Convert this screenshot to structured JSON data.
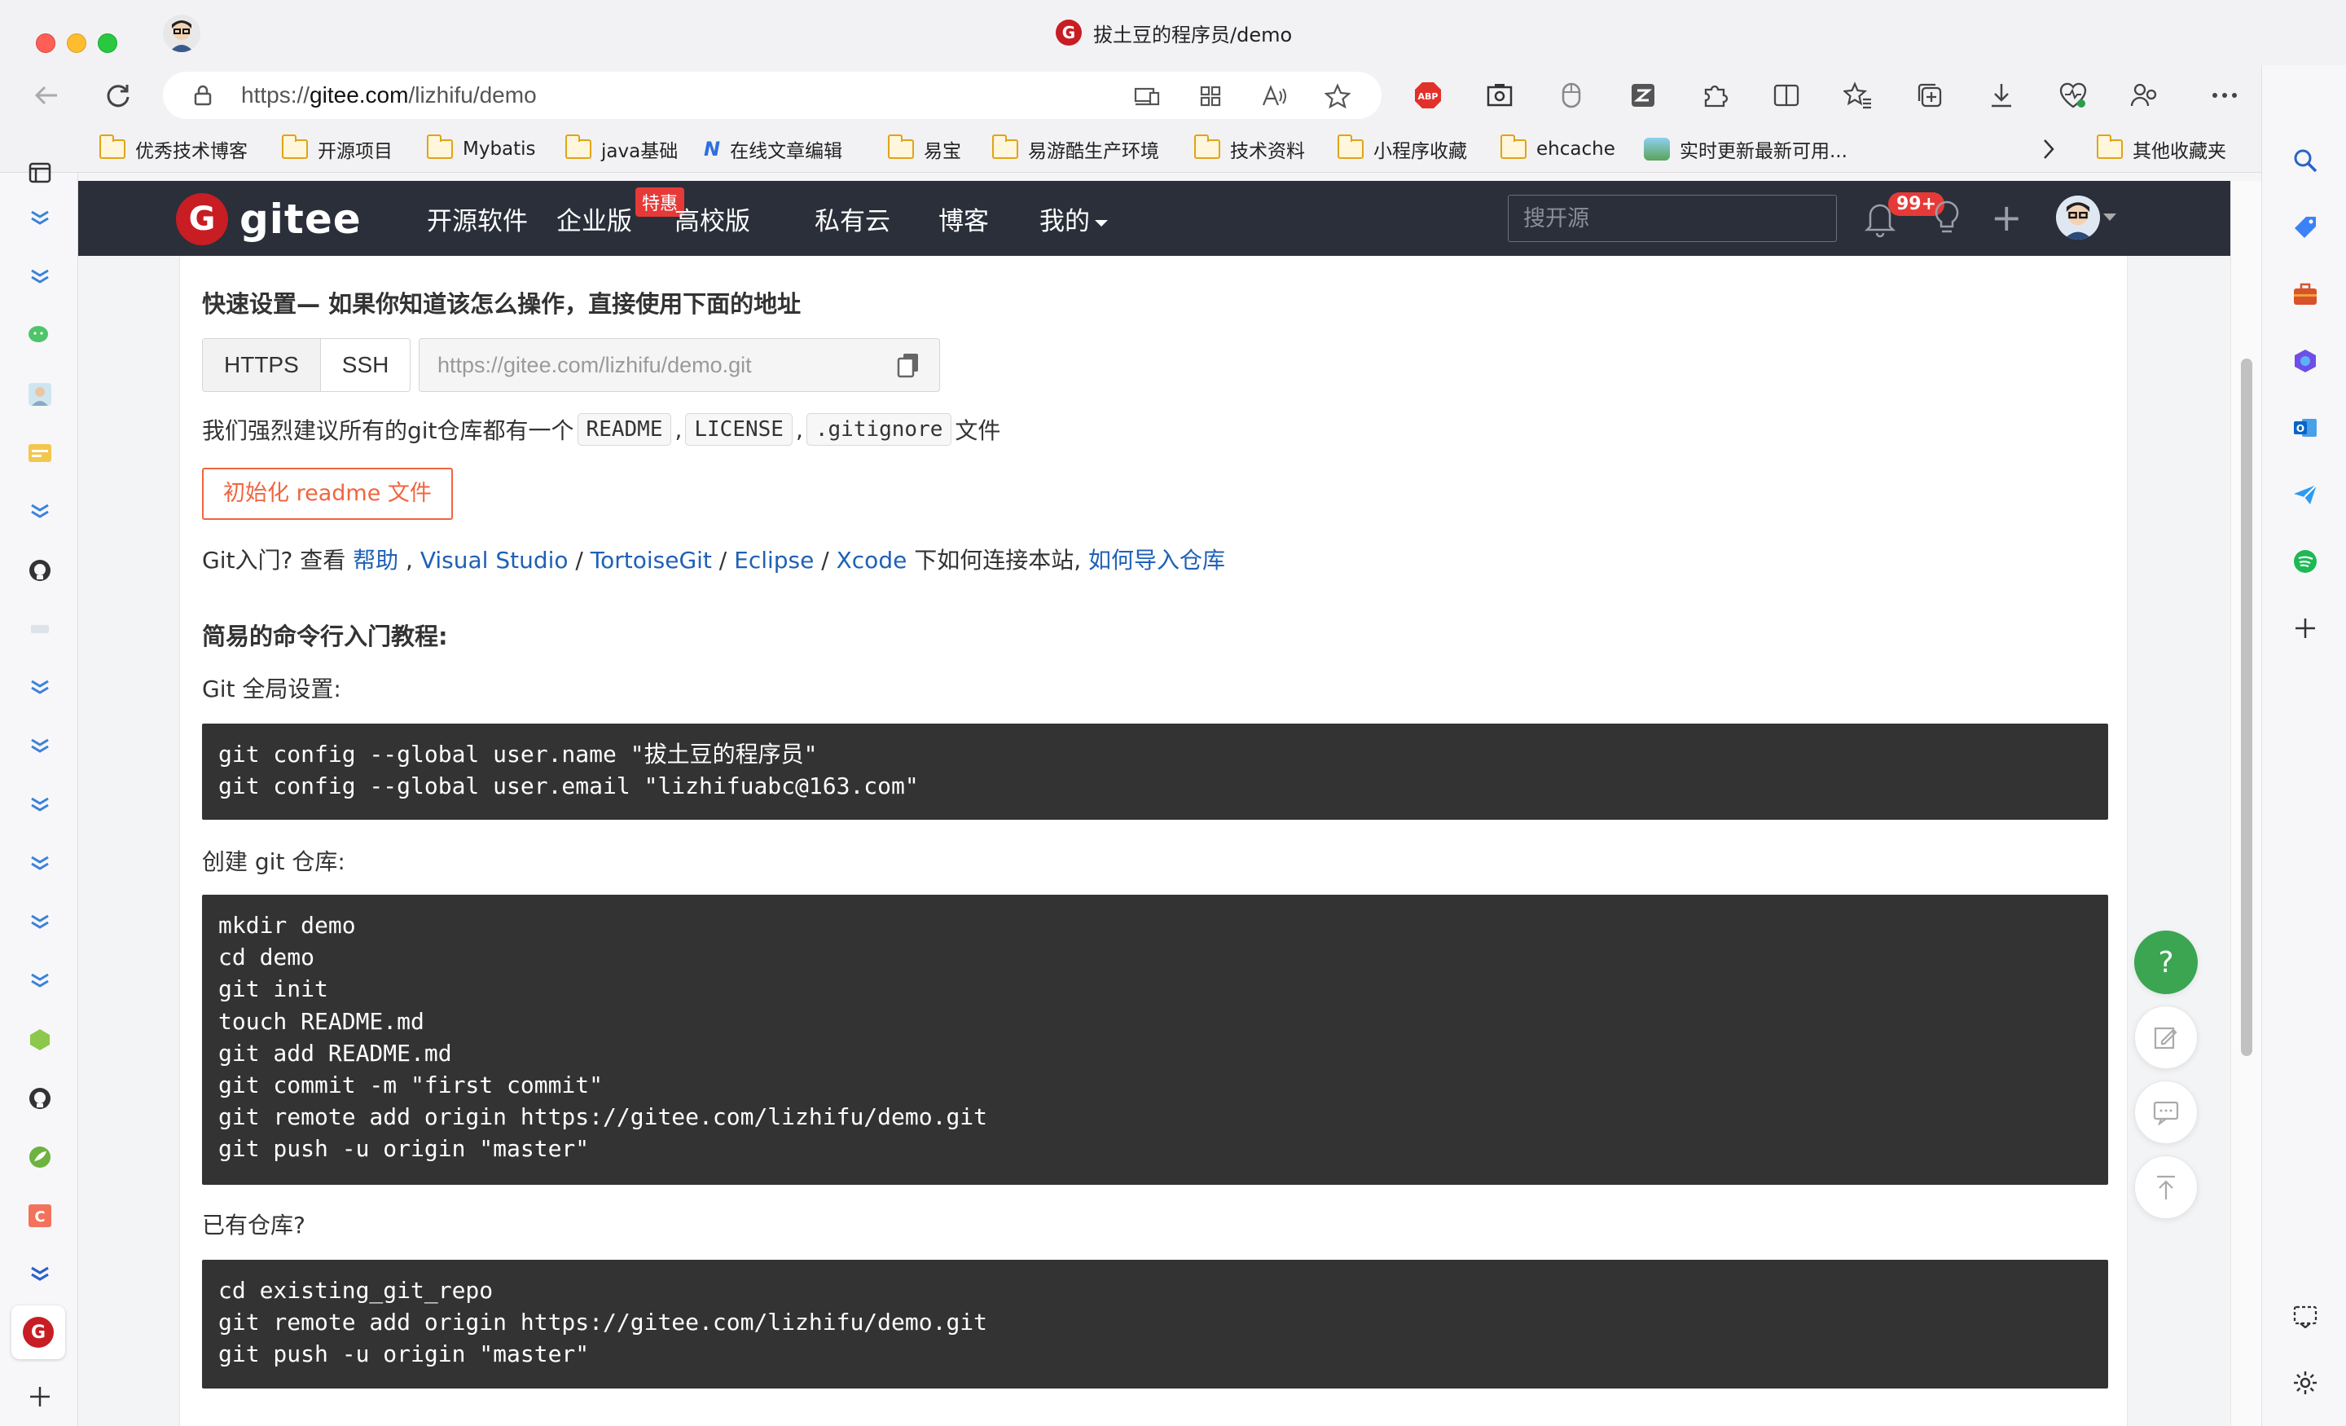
{
  "window": {
    "title": "拔土豆的程序员/demo"
  },
  "address_bar": {
    "url_prefix": "https://",
    "url_domain": "gitee.com",
    "url_path": "/lizhifu/demo"
  },
  "bookmarks": [
    {
      "label": "优秀技术博客",
      "icon": "folder-icon"
    },
    {
      "label": "开源项目",
      "icon": "folder-icon"
    },
    {
      "label": "Mybatis",
      "icon": "folder-icon"
    },
    {
      "label": "java基础",
      "icon": "folder-icon"
    },
    {
      "label": "在线文章编辑",
      "icon": "site-icon"
    },
    {
      "label": "易宝",
      "icon": "folder-icon"
    },
    {
      "label": "易游酷生产环境",
      "icon": "folder-icon"
    },
    {
      "label": "技术资料",
      "icon": "folder-icon"
    },
    {
      "label": "小程序收藏",
      "icon": "folder-icon"
    },
    {
      "label": "ehcache",
      "icon": "folder-icon"
    },
    {
      "label": "实时更新最新可用...",
      "icon": "site-icon"
    },
    {
      "label": "其他收藏夹",
      "icon": "folder-icon"
    }
  ],
  "gitee_nav": {
    "logo_text": "gitee",
    "items": [
      "开源软件",
      "企业版",
      "高校版",
      "私有云",
      "博客",
      "我的"
    ],
    "enterprise_badge": "特惠",
    "search_placeholder": "搜开源",
    "notification_count": "99+"
  },
  "quick_setup": {
    "title": "快速设置— 如果你知道该怎么操作，直接使用下面的地址",
    "protocols": [
      "HTTPS",
      "SSH"
    ],
    "selected_protocol": "SSH",
    "repo_url": "https://gitee.com/lizhifu/demo.git",
    "recommend_prefix": "我们强烈建议所有的git仓库都有一个",
    "recommend_files": [
      "README",
      "LICENSE",
      ".gitignore"
    ],
    "recommend_suffix": "文件",
    "init_button": "初始化 readme 文件"
  },
  "git_help": {
    "prefix": "Git入门? 查看 ",
    "help_link": "帮助",
    "sep1": " , ",
    "vs_link": "Visual Studio",
    "sep2": " / ",
    "tortoise_link": "TortoiseGit",
    "sep3": " / ",
    "eclipse_link": "Eclipse",
    "sep4": " / ",
    "xcode_link": "Xcode",
    "middle": " 下如何连接本站, ",
    "import_link": "如何导入仓库"
  },
  "tutorial": {
    "title": "简易的命令行入门教程:",
    "global_label": "Git 全局设置:",
    "global_code": "git config --global user.name \"拔土豆的程序员\"\ngit config --global user.email \"lizhifuabc@163.com\"",
    "create_label": "创建 git 仓库:",
    "create_code": "mkdir demo\ncd demo\ngit init\ntouch README.md\ngit add README.md\ngit commit -m \"first commit\"\ngit remote add origin https://gitee.com/lizhifu/demo.git\ngit push -u origin \"master\"",
    "existing_label": "已有仓库?",
    "existing_code": "cd existing_git_repo\ngit remote add origin https://gitee.com/lizhifu/demo.git\ngit push -u origin \"master\""
  },
  "floating": {
    "help_symbol": "?"
  },
  "colors": {
    "gitee_red": "#c71d23",
    "nav_bg": "#2a2f3a",
    "link_blue": "#1f61b6",
    "init_orange": "#f0653f",
    "help_green": "#3ba552"
  }
}
